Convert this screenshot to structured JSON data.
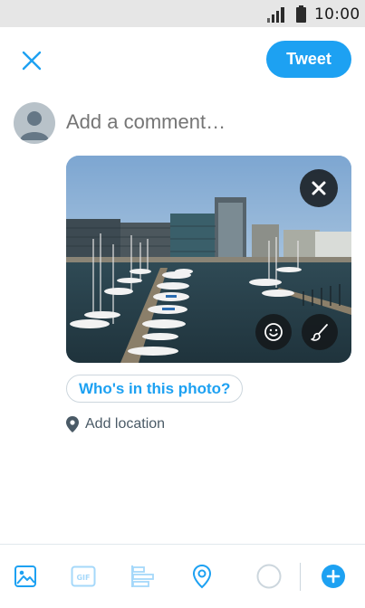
{
  "status_bar": {
    "time": "10:00"
  },
  "compose": {
    "close_icon": "close-icon",
    "tweet_label": "Tweet",
    "comment_placeholder": "Add a comment…",
    "tag_people_label": "Who's in this photo?",
    "location_label": "Add location"
  },
  "toolbar": {
    "items": [
      "gallery-icon",
      "gif-icon",
      "poll-icon",
      "location-icon",
      "character-counter",
      "add-thread-icon"
    ]
  },
  "colors": {
    "accent": "#1da1f2",
    "status_bar": "#e6e6e6",
    "muted_text": "#657786",
    "divider": "#e1e8ed",
    "disabled_icon": "#a5d8fa"
  }
}
